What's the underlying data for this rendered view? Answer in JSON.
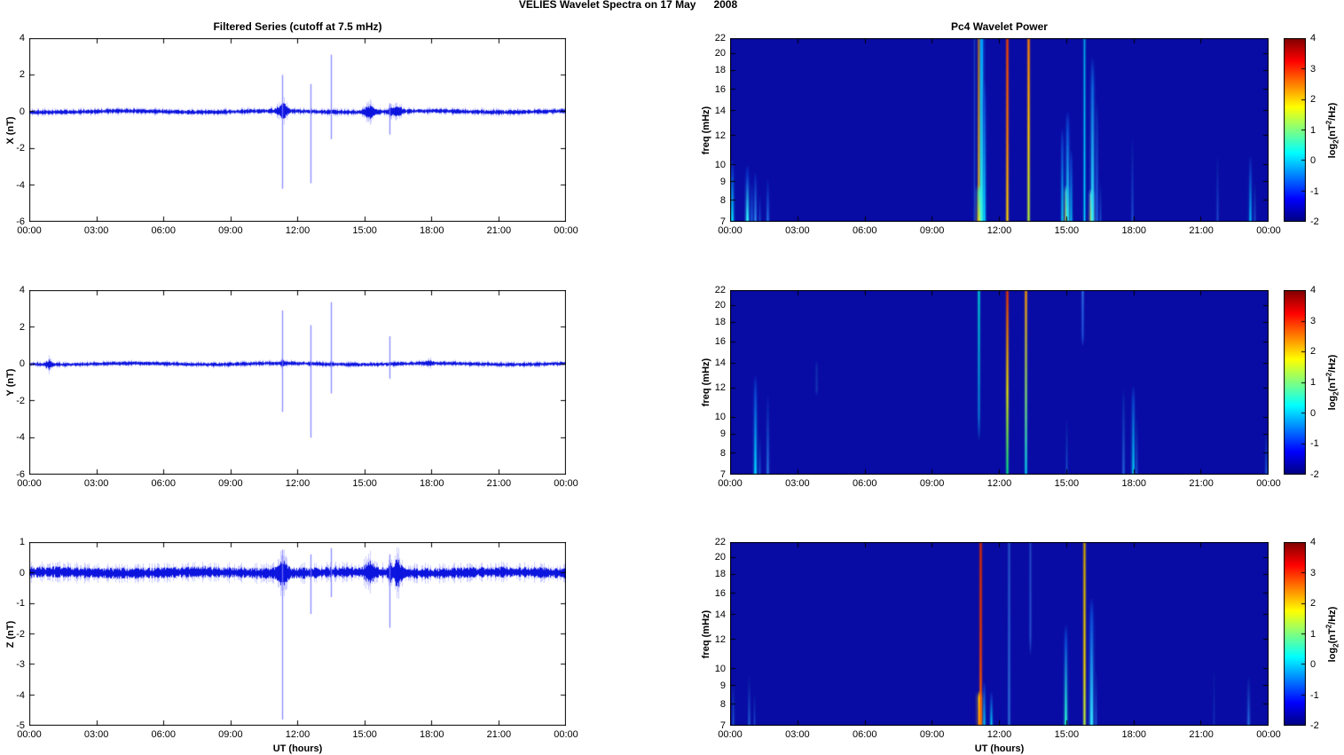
{
  "chart_data": {
    "suptitle": "VELIES Wavelet Spectra on 17 May      2008",
    "x_axis": {
      "label": "UT (hours)",
      "ticks": [
        "00:00",
        "03:00",
        "06:00",
        "09:00",
        "12:00",
        "15:00",
        "18:00",
        "21:00",
        "00:00"
      ],
      "range_hours": [
        0,
        24
      ]
    },
    "timeseries": {
      "type": "line",
      "title": "Filtered Series (cutoff at 7.5 mHz)",
      "line_color": "#0008dc",
      "spike_color": "#7878ff",
      "panels": [
        {
          "id": "x-filtered-series",
          "ylabel": "X (nT)",
          "ylim": [
            -6,
            4
          ],
          "yticks": [
            4,
            2,
            0,
            -2,
            -4,
            -6
          ],
          "noise_amp": 0.09,
          "seed": 7,
          "spikes": [
            {
              "t": 11.3,
              "hi": 2.0,
              "lo": -4.2
            },
            {
              "t": 12.58,
              "hi": 1.5,
              "lo": -3.9
            },
            {
              "t": 13.5,
              "hi": 3.1,
              "lo": -1.5
            },
            {
              "t": 16.1,
              "hi": 0.45,
              "lo": -1.25
            }
          ],
          "bursts": [
            {
              "t": 11.32,
              "w": 0.22,
              "amp": 0.3
            },
            {
              "t": 15.2,
              "w": 0.25,
              "amp": 0.22
            },
            {
              "t": 16.12,
              "w": 0.1,
              "amp": 0.15
            },
            {
              "t": 16.45,
              "w": 0.18,
              "amp": 0.22
            }
          ]
        },
        {
          "id": "y-filtered-series",
          "ylabel": "Y (nT)",
          "ylim": [
            -6,
            4
          ],
          "yticks": [
            4,
            2,
            0,
            -2,
            -4,
            -6
          ],
          "noise_amp": 0.075,
          "seed": 13,
          "spikes": [
            {
              "t": 11.3,
              "hi": 2.9,
              "lo": -2.6
            },
            {
              "t": 12.58,
              "hi": 2.1,
              "lo": -4.0
            },
            {
              "t": 13.5,
              "hi": 3.35,
              "lo": -1.6
            },
            {
              "t": 16.1,
              "hi": 1.5,
              "lo": -0.8
            }
          ],
          "bursts": [
            {
              "t": 0.85,
              "w": 0.12,
              "amp": 0.18
            },
            {
              "t": 11.32,
              "w": 0.1,
              "amp": 0.12
            },
            {
              "t": 17.9,
              "w": 0.15,
              "amp": 0.1
            }
          ]
        },
        {
          "id": "z-filtered-series",
          "ylabel": "Z (nT)",
          "ylim": [
            -5,
            1
          ],
          "yticks": [
            1,
            0,
            -1,
            -2,
            -3,
            -4,
            -5
          ],
          "noise_amp": 0.13,
          "seed": 29,
          "spikes": [
            {
              "t": 11.3,
              "hi": 0.75,
              "lo": -4.8
            },
            {
              "t": 12.58,
              "hi": 0.6,
              "lo": -1.35
            },
            {
              "t": 13.5,
              "hi": 0.8,
              "lo": -0.8
            },
            {
              "t": 16.1,
              "hi": 0.6,
              "lo": -1.8
            }
          ],
          "bursts": [
            {
              "t": 11.32,
              "w": 0.22,
              "amp": 0.28
            },
            {
              "t": 15.2,
              "w": 0.2,
              "amp": 0.2
            },
            {
              "t": 16.12,
              "w": 0.08,
              "amp": 0.2
            },
            {
              "t": 16.45,
              "w": 0.2,
              "amp": 0.25
            }
          ]
        }
      ]
    },
    "spectrograms": {
      "type": "heatmap",
      "title": "Pc4 Wavelet Power",
      "ylabel": "freq (mHz)",
      "yscale": "log",
      "ylim": [
        7,
        22
      ],
      "yticks": [
        22,
        20,
        18,
        16,
        14,
        12,
        10,
        9,
        8,
        7
      ],
      "bg_color": "#080ba4",
      "colormap": "jet",
      "colorbar": {
        "clim": [
          -2,
          4
        ],
        "ticks": [
          4,
          3,
          2,
          1,
          0,
          -1,
          -2
        ],
        "label_parts": {
          "pre": "log",
          "sub": "2",
          "mid": "(nT",
          "sup": "2",
          "post": "/Hz)"
        }
      },
      "panels": [
        {
          "id": "x-wavelet-power",
          "features": [
            {
              "t": 0.07,
              "f_lo": 7,
              "f_hi": 10.4,
              "c_lo": "#00e5ff",
              "c_hi": "#0a32c8",
              "w": 2
            },
            {
              "t": 0.75,
              "f_lo": 7,
              "f_hi": 10.0,
              "c_lo": "#30ffff",
              "c_hi": "#0a32c8",
              "w": 2.2
            },
            {
              "t": 0.95,
              "f_lo": 7,
              "f_hi": 9.0,
              "c_lo": "#1565e0",
              "c_hi": "#0a20b4",
              "w": 1.4
            },
            {
              "t": 1.12,
              "f_lo": 7,
              "f_hi": 9.6,
              "c_lo": "#2e8cf0",
              "c_hi": "#0a28bc",
              "w": 1.8
            },
            {
              "t": 1.3,
              "f_lo": 7,
              "f_hi": 8.4,
              "c_lo": "#1550d2",
              "c_hi": "#0a18ac",
              "w": 1.2
            },
            {
              "t": 1.68,
              "f_lo": 7,
              "f_hi": 9.2,
              "c_lo": "#1e6ee6",
              "c_hi": "#0a20b4",
              "w": 1.8
            },
            {
              "t": 10.88,
              "f_lo": 7,
              "f_hi": 22,
              "c_lo": "#1440c8",
              "c_hi": "#1038b8",
              "w": 1.2
            },
            {
              "t": 11.06,
              "f_lo": 7,
              "f_hi": 22,
              "c_lo": "#ffb400",
              "c_hi": "#c86400",
              "w": 1.6
            },
            {
              "t": 11.12,
              "f_lo": 7,
              "f_hi": 8.8,
              "c_lo": "#ffdc00",
              "c_hi": "#50e0a0",
              "w": 3.4
            },
            {
              "t": 11.18,
              "f_lo": 7,
              "f_hi": 22,
              "c_lo": "#40ffe0",
              "c_hi": "#00a0ff",
              "w": 2.6
            },
            {
              "t": 11.3,
              "f_lo": 7,
              "f_hi": 17,
              "c_lo": "#00d2ff",
              "c_hi": "#0c50d8",
              "w": 2
            },
            {
              "t": 12.32,
              "f_lo": 7,
              "f_hi": 22,
              "stops": [
                [
                  0,
                  "#ffd400"
                ],
                [
                  0.5,
                  "#ff7800"
                ],
                [
                  1,
                  "#f03c00"
                ]
              ],
              "w": 1.6
            },
            {
              "t": 13.3,
              "f_lo": 7,
              "f_hi": 22,
              "stops": [
                [
                  0,
                  "#b4f03c"
                ],
                [
                  0.5,
                  "#ffc800"
                ],
                [
                  1,
                  "#ff8200"
                ]
              ],
              "w": 1.6
            },
            {
              "t": 14.78,
              "f_lo": 7,
              "f_hi": 12.6,
              "c_lo": "#00c8f0",
              "c_hi": "#0c46d2",
              "w": 1.6
            },
            {
              "t": 14.99,
              "f_lo": 7,
              "f_hi": 8.8,
              "c_lo": "#ffc800",
              "c_hi": "#60e6b4",
              "w": 2.6
            },
            {
              "t": 15.02,
              "f_lo": 7,
              "f_hi": 14,
              "c_lo": "#20f0ff",
              "c_hi": "#0c50d8",
              "w": 2.2
            },
            {
              "t": 15.18,
              "f_lo": 7,
              "f_hi": 11,
              "c_lo": "#00b4f0",
              "c_hi": "#0c3cc8",
              "w": 1.6
            },
            {
              "t": 15.78,
              "f_lo": 7,
              "f_hi": 22,
              "c_lo": "#00d2ff",
              "c_hi": "#00a0e6",
              "w": 1.3
            },
            {
              "t": 16.08,
              "f_lo": 7,
              "f_hi": 8.6,
              "c_lo": "#ffe100",
              "c_hi": "#80e6c8",
              "w": 2.6
            },
            {
              "t": 16.12,
              "f_lo": 7,
              "f_hi": 19.6,
              "c_lo": "#30f0ff",
              "c_hi": "#0c64dc",
              "w": 2.4
            },
            {
              "t": 16.32,
              "f_lo": 7,
              "f_hi": 15,
              "c_lo": "#2064e6",
              "c_hi": "#0c2cb4",
              "w": 1.6
            },
            {
              "t": 16.5,
              "f_lo": 7,
              "f_hi": 9,
              "c_lo": "#1a50cc",
              "c_hi": "#0a1ea8",
              "w": 1.2
            },
            {
              "t": 17.92,
              "f_lo": 7,
              "f_hi": 12,
              "c_lo": "#1a4fd0",
              "c_hi": "#0a1ea8",
              "w": 1.4
            },
            {
              "t": 21.7,
              "f_lo": 7,
              "f_hi": 10.6,
              "c_lo": "#1a46cc",
              "c_hi": "#0a1ea8",
              "w": 1.4
            },
            {
              "t": 23.18,
              "f_lo": 7,
              "f_hi": 10.6,
              "c_lo": "#00b4f5",
              "c_hi": "#0c32c0",
              "w": 1.8
            },
            {
              "t": 23.35,
              "f_lo": 7,
              "f_hi": 9,
              "c_lo": "#1a50cc",
              "c_hi": "#0a1ea8",
              "w": 1.2
            }
          ]
        },
        {
          "id": "y-wavelet-power",
          "features": [
            {
              "t": 1.1,
              "f_lo": 7,
              "f_hi": 13,
              "c_lo": "#00dcff",
              "c_hi": "#0c46d2",
              "w": 2
            },
            {
              "t": 1.32,
              "f_lo": 7,
              "f_hi": 9,
              "c_lo": "#1455d2",
              "c_hi": "#0a1ea8",
              "w": 1.2
            },
            {
              "t": 1.68,
              "f_lo": 7,
              "f_hi": 11.6,
              "c_lo": "#2372e0",
              "c_hi": "#0a23b0",
              "w": 1.8
            },
            {
              "t": 3.85,
              "f_lo": 11.4,
              "f_hi": 14.2,
              "c_lo": "#1232b4",
              "c_hi": "#0e28ac",
              "w": 1.6
            },
            {
              "t": 11.06,
              "f_lo": 8.6,
              "f_hi": 22,
              "c_lo": "#0b78d2",
              "c_hi": "#00d2d2",
              "w": 1.5
            },
            {
              "t": 12.32,
              "f_lo": 7,
              "f_hi": 22,
              "stops": [
                [
                  0,
                  "#00d78c"
                ],
                [
                  0.45,
                  "#e6e100"
                ],
                [
                  1,
                  "#e63200"
                ]
              ],
              "w": 1.6
            },
            {
              "t": 13.17,
              "f_lo": 7,
              "f_hi": 22,
              "stops": [
                [
                  0,
                  "#00cdf0"
                ],
                [
                  0.4,
                  "#78dc78"
                ],
                [
                  1,
                  "#ff9b00"
                ]
              ],
              "w": 1.5
            },
            {
              "t": 15.0,
              "f_lo": 7,
              "f_hi": 10,
              "c_lo": "#1450cc",
              "c_hi": "#0a1ea8",
              "w": 1.3
            },
            {
              "t": 15.7,
              "f_lo": 15.5,
              "f_hi": 22,
              "c_lo": "#1c50d8",
              "c_hi": "#2e6ee6",
              "w": 1.4
            },
            {
              "t": 17.52,
              "f_lo": 7,
              "f_hi": 12,
              "c_lo": "#2064d8",
              "c_hi": "#0c28b0",
              "w": 1.6
            },
            {
              "t": 17.96,
              "f_lo": 7,
              "f_hi": 12.2,
              "c_lo": "#00c8f0",
              "c_hi": "#0c46cc",
              "w": 2
            },
            {
              "t": 18.12,
              "f_lo": 7,
              "f_hi": 10,
              "c_lo": "#1a50cc",
              "c_hi": "#0a1ea8",
              "w": 1.2
            },
            {
              "t": 23.9,
              "f_lo": 7,
              "f_hi": 9.2,
              "c_lo": "#1a55d2",
              "c_hi": "#0a1ea8",
              "w": 1.6
            }
          ]
        },
        {
          "id": "z-wavelet-power",
          "features": [
            {
              "t": 0.1,
              "f_lo": 7,
              "f_hi": 9.2,
              "c_lo": "#1a50cc",
              "c_hi": "#0a1ea8",
              "w": 1.5
            },
            {
              "t": 0.85,
              "f_lo": 7,
              "f_hi": 9.6,
              "c_lo": "#1e5ad2",
              "c_hi": "#0a1ea8",
              "w": 1.6
            },
            {
              "t": 1.05,
              "f_lo": 7,
              "f_hi": 8.6,
              "c_lo": "#1646c8",
              "c_hi": "#0a1aa4",
              "w": 1.2
            },
            {
              "t": 11.12,
              "f_lo": 7,
              "f_hi": 8.7,
              "c_lo": "#ff9b00",
              "c_hi": "#ffdc00",
              "w": 3
            },
            {
              "t": 11.16,
              "f_lo": 7,
              "f_hi": 22,
              "stops": [
                [
                  0,
                  "#ff6e00"
                ],
                [
                  0.4,
                  "#e63c00"
                ],
                [
                  1,
                  "#cd2800"
                ]
              ],
              "w": 1.7
            },
            {
              "t": 11.3,
              "f_lo": 7,
              "f_hi": 9.2,
              "c_lo": "#00c3f0",
              "c_hi": "#0c3cc8",
              "w": 1.6
            },
            {
              "t": 11.62,
              "f_lo": 7,
              "f_hi": 8.7,
              "c_lo": "#00cdf5",
              "c_hi": "#0c32c0",
              "w": 1.6
            },
            {
              "t": 12.42,
              "f_lo": 7,
              "f_hi": 22,
              "c_lo": "#2e6ed8",
              "c_hi": "#2350c8",
              "w": 1.5
            },
            {
              "t": 13.37,
              "f_lo": 10.8,
              "f_hi": 22,
              "c_lo": "#2350c8",
              "c_hi": "#1e46c0",
              "w": 1.4
            },
            {
              "t": 14.95,
              "f_lo": 7,
              "f_hi": 13.2,
              "c_lo": "#28ffd2",
              "c_hi": "#0c50d8",
              "w": 2
            },
            {
              "t": 15.78,
              "f_lo": 7,
              "f_hi": 22,
              "stops": [
                [
                  0,
                  "#b4f046"
                ],
                [
                  0.3,
                  "#e6d200"
                ],
                [
                  1,
                  "#c8a000"
                ]
              ],
              "w": 1.6
            },
            {
              "t": 16.1,
              "f_lo": 7,
              "f_hi": 15.6,
              "c_lo": "#32e6ff",
              "c_hi": "#0c50d8",
              "w": 2.6
            },
            {
              "t": 16.3,
              "f_lo": 7,
              "f_hi": 10,
              "c_lo": "#1a50cc",
              "c_hi": "#0a1ea8",
              "w": 1.3
            },
            {
              "t": 21.55,
              "f_lo": 7,
              "f_hi": 10,
              "c_lo": "#102db4",
              "c_hi": "#0a1aa4",
              "w": 1.2
            },
            {
              "t": 23.1,
              "f_lo": 7,
              "f_hi": 9.6,
              "c_lo": "#2468e0",
              "c_hi": "#0c23ac",
              "w": 1.9
            }
          ]
        }
      ]
    }
  }
}
